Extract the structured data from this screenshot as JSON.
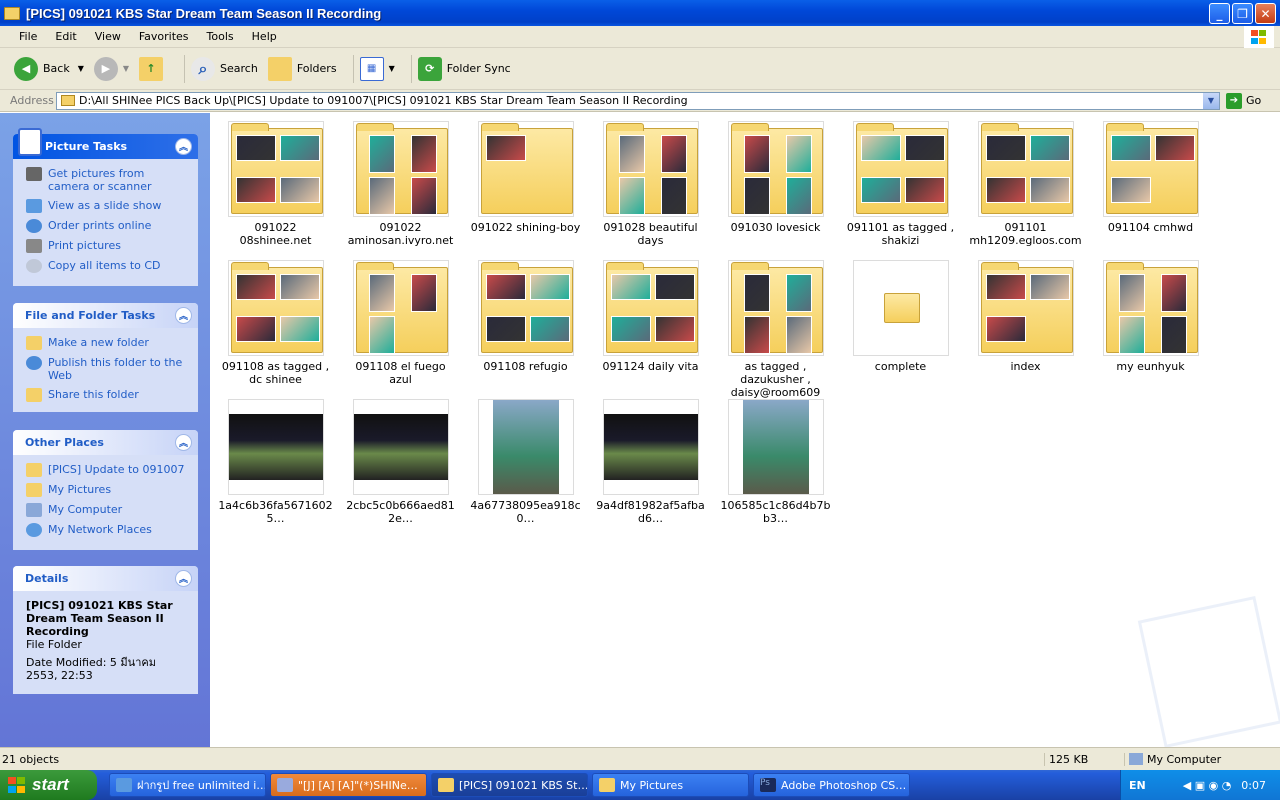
{
  "window": {
    "title": "[PICS] 091021 KBS Star Dream Team Season II Recording"
  },
  "menu": [
    "File",
    "Edit",
    "View",
    "Favorites",
    "Tools",
    "Help"
  ],
  "toolbar": {
    "back": "Back",
    "search": "Search",
    "folders": "Folders",
    "sync": "Folder Sync"
  },
  "address": {
    "label": "Address",
    "path": "D:\\All SHINee PICS Back Up\\[PICS] Update to 091007\\[PICS] 091021 KBS Star Dream Team Season II Recording",
    "go": "Go"
  },
  "picture_tasks": {
    "title": "Picture Tasks",
    "items": [
      "Get pictures from camera or scanner",
      "View as a slide show",
      "Order prints online",
      "Print pictures",
      "Copy all items to CD"
    ]
  },
  "file_tasks": {
    "title": "File and Folder Tasks",
    "items": [
      "Make a new folder",
      "Publish this folder to the Web",
      "Share this folder"
    ]
  },
  "other_places": {
    "title": "Other Places",
    "items": [
      "[PICS] Update to 091007",
      "My Pictures",
      "My Computer",
      "My Network Places"
    ]
  },
  "details": {
    "title": "Details",
    "name": "[PICS] 091021 KBS Star Dream Team Season II Recording",
    "type": "File Folder",
    "modified": "Date Modified: 5 มีนาคม 2553, 22:53"
  },
  "files": [
    "091022 08shinee.net",
    "091022 aminosan.ivyro.net",
    "091022 shining-boy",
    "091028 beautiful days",
    "091030 lovesick",
    "091101 as tagged , shakizi",
    "091101 mh1209.egloos.com",
    "091104 cmhwd",
    "091108 as tagged , dc shinee",
    "091108 el fuego azul",
    "091108 refugio",
    "091124 daily vita",
    "as tagged , dazukusher , daisy@room609",
    "complete",
    "index",
    "my eunhyuk",
    "1a4c6b36fa56716025…",
    "2cbc5c0b666aed812e…",
    "4a67738095ea918c0…",
    "9a4df81982af5afbad6…",
    "106585c1c86d4b7bb3…"
  ],
  "status": {
    "count": "21 objects",
    "size": "125 KB",
    "location": "My Computer"
  },
  "taskbar": {
    "start": "start",
    "tasks": [
      "ฝากรูป free unlimited i…",
      "\"[J] [A] [A]\"(*)SHINe…",
      "[PICS] 091021 KBS St…",
      "My Pictures",
      "Adobe Photoshop CS…"
    ],
    "lang": "EN",
    "clock": "0:07"
  }
}
